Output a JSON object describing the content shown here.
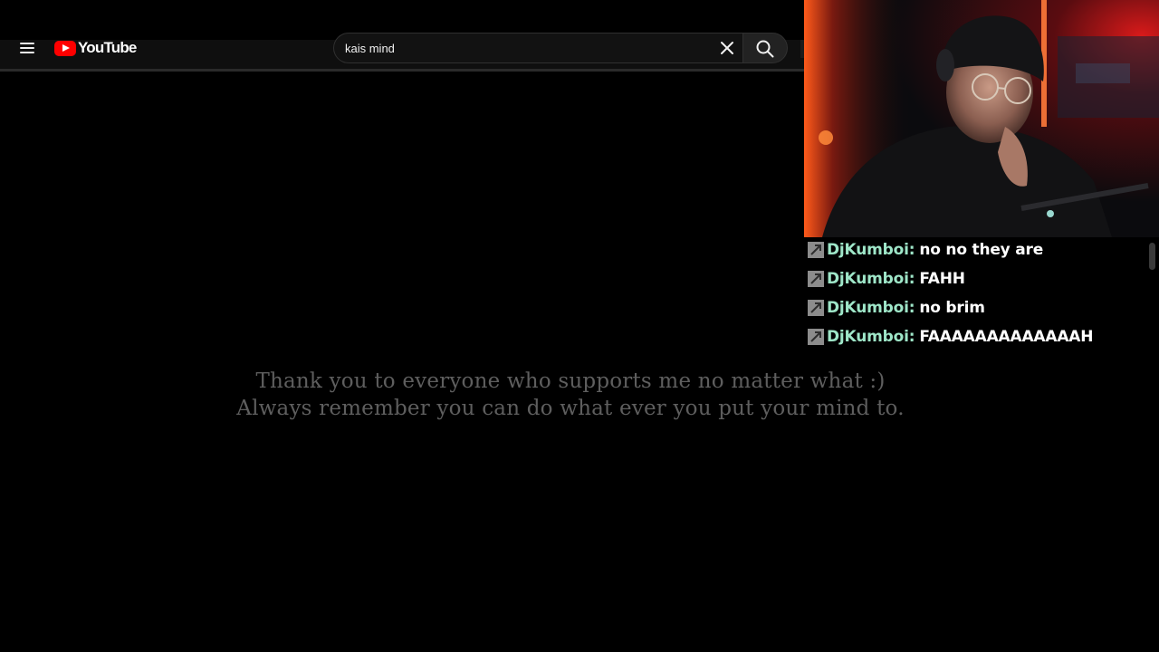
{
  "youtube": {
    "logo_text": "YouTube",
    "search": {
      "value": "kais mind",
      "placeholder": "Search"
    },
    "icons": {
      "menu": "hamburger-menu-icon",
      "logo": "youtube-logo-icon",
      "clear": "close-icon",
      "search": "search-icon"
    },
    "video": {
      "message_line_1": "Thank you to everyone who supports me no matter what :)",
      "message_line_2": "Always remember you can do what ever you put your mind to."
    }
  },
  "chat": {
    "badge_icon": "arrow-badge-icon",
    "messages": [
      {
        "user": "DjKumboi",
        "text": "no no they are"
      },
      {
        "user": "DjKumboi",
        "text": "FAHH"
      },
      {
        "user": "DjKumboi",
        "text": "no brim"
      },
      {
        "user": "DjKumboi",
        "text": "FAAAAAAAAAAAAAH"
      }
    ]
  },
  "colors": {
    "youtube_red": "#ff0000",
    "chat_username": "#9ee6c8",
    "chat_text": "#ffffff",
    "video_message": "#5e5e5e",
    "header_bg": "#0f0f0f"
  }
}
